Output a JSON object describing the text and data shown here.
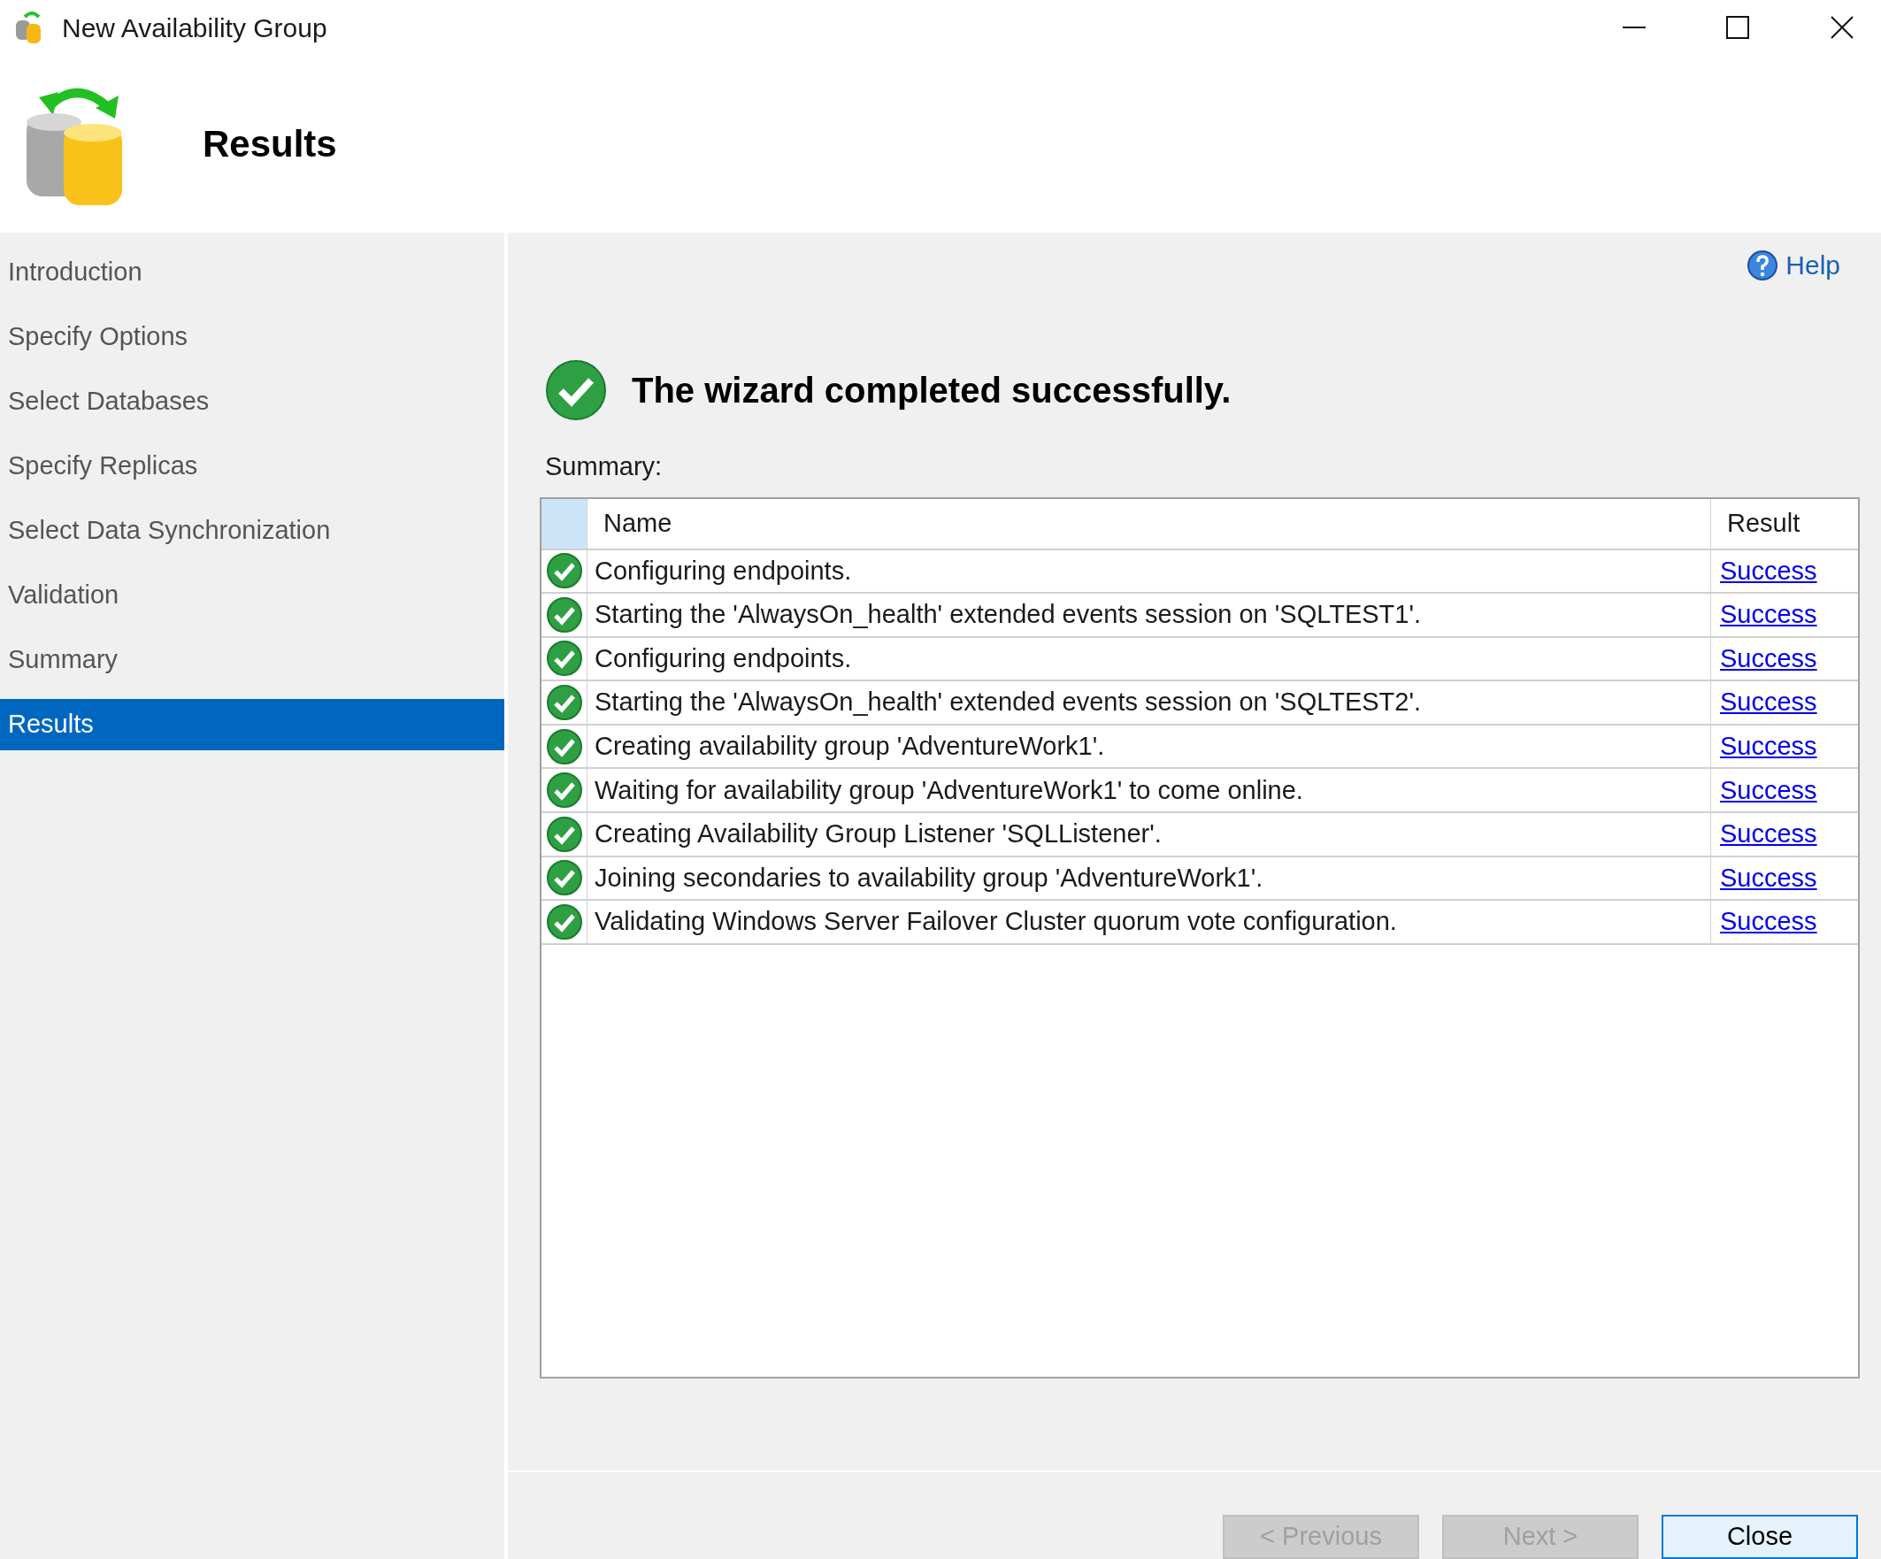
{
  "window": {
    "title": "New Availability Group"
  },
  "header": {
    "title": "Results"
  },
  "sidebar": {
    "items": [
      {
        "label": "Introduction",
        "selected": false
      },
      {
        "label": "Specify Options",
        "selected": false
      },
      {
        "label": "Select Databases",
        "selected": false
      },
      {
        "label": "Specify Replicas",
        "selected": false
      },
      {
        "label": "Select Data Synchronization",
        "selected": false
      },
      {
        "label": "Validation",
        "selected": false
      },
      {
        "label": "Summary",
        "selected": false
      },
      {
        "label": "Results",
        "selected": true
      }
    ]
  },
  "help": "Help",
  "message": "The wizard completed successfully.",
  "summary_label": "Summary:",
  "table": {
    "columns": [
      "Name",
      "Result"
    ],
    "rows": [
      {
        "name": "Configuring endpoints.",
        "result": "Success"
      },
      {
        "name": "Starting the 'AlwaysOn_health' extended events session on 'SQLTEST1'.",
        "result": "Success"
      },
      {
        "name": "Configuring endpoints.",
        "result": "Success"
      },
      {
        "name": "Starting the 'AlwaysOn_health' extended events session on 'SQLTEST2'.",
        "result": "Success"
      },
      {
        "name": "Creating availability group 'AdventureWork1'.",
        "result": "Success"
      },
      {
        "name": "Waiting for availability group 'AdventureWork1' to come online.",
        "result": "Success"
      },
      {
        "name": "Creating Availability Group Listener 'SQLListener'.",
        "result": "Success"
      },
      {
        "name": "Joining secondaries to availability group 'AdventureWork1'.",
        "result": "Success"
      },
      {
        "name": "Validating Windows Server Failover Cluster quorum vote configuration.",
        "result": "Success"
      }
    ]
  },
  "buttons": [
    {
      "label": "< Previous",
      "disabled": true,
      "default": false
    },
    {
      "label": "Next >",
      "disabled": true,
      "default": false
    },
    {
      "label": "Close",
      "disabled": false,
      "default": true
    }
  ]
}
